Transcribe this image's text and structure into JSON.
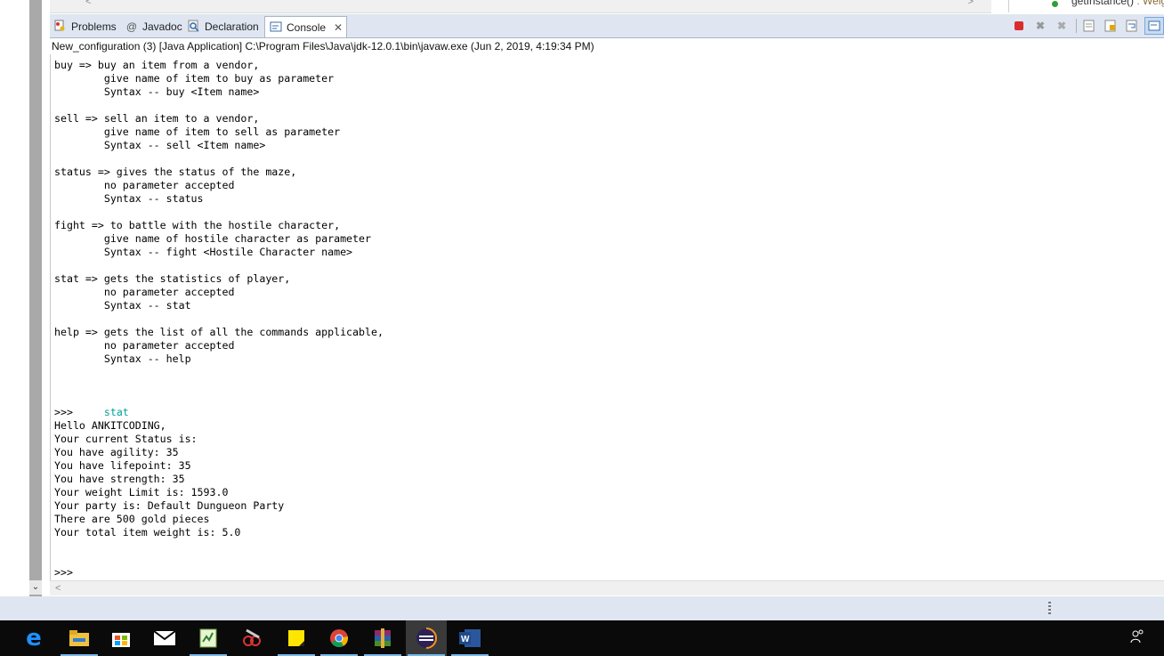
{
  "outline": {
    "method": "getInstance()",
    "type_hint": ": Weig"
  },
  "tabs": [
    {
      "label": "Problems",
      "icon": "problems-icon",
      "active": false
    },
    {
      "label": "Javadoc",
      "icon": "javadoc-icon",
      "active": false
    },
    {
      "label": "Declaration",
      "icon": "declaration-icon",
      "active": false
    },
    {
      "label": "Console",
      "icon": "console-icon",
      "active": true
    }
  ],
  "toolbar": {
    "buttons": [
      "terminate-icon",
      "remove-launch-icon",
      "remove-all-terminated-icon",
      "clear-console-icon",
      "scroll-lock-icon",
      "word-wrap-icon",
      "display-selected-console-icon"
    ]
  },
  "console": {
    "header": "New_configuration (3) [Java Application] C:\\Program Files\\Java\\jdk-12.0.1\\bin\\javaw.exe (Jun 2, 2019, 4:19:34 PM)",
    "help_text": "buy => buy an item from a vendor,\n        give name of item to buy as parameter\n        Syntax -- buy <Item name>\n\nsell => sell an item to a vendor,\n        give name of item to sell as parameter\n        Syntax -- sell <Item name>\n\nstatus => gives the status of the maze,\n        no parameter accepted\n        Syntax -- status\n\nfight => to battle with the hostile character,\n        give name of hostile character as parameter\n        Syntax -- fight <Hostile Character name>\n\nstat => gets the statistics of player,\n        no parameter accepted\n        Syntax -- stat\n\nhelp => gets the list of all the commands applicable,\n        no parameter accepted\n        Syntax -- help\n\n\n\n",
    "prompt1": ">>>",
    "user_input": "stat",
    "output_text": "Hello ANKITCODING,\nYour current Status is:\nYou have agility: 35\nYou have lifepoint: 35\nYou have strength: 35\nYour weight Limit is: 1593.0\nYour party is: Default Dungueon Party\nThere are 500 gold pieces\nYour total item weight is: 5.0\n\n\n",
    "prompt2": ">>>"
  },
  "taskbar": {
    "apps": [
      "edge-icon",
      "file-explorer-icon",
      "store-icon",
      "mail-icon",
      "notepad-icon",
      "snipping-tool-icon",
      "sticky-notes-icon",
      "chrome-icon",
      "winrar-icon",
      "eclipse-icon",
      "word-icon"
    ],
    "active_app": "eclipse-icon",
    "tray": "person-icon"
  },
  "colors": {
    "input_text": "#00a19a",
    "tab_bar": "#dfe6f1",
    "taskbar": "#0a0a0a"
  }
}
